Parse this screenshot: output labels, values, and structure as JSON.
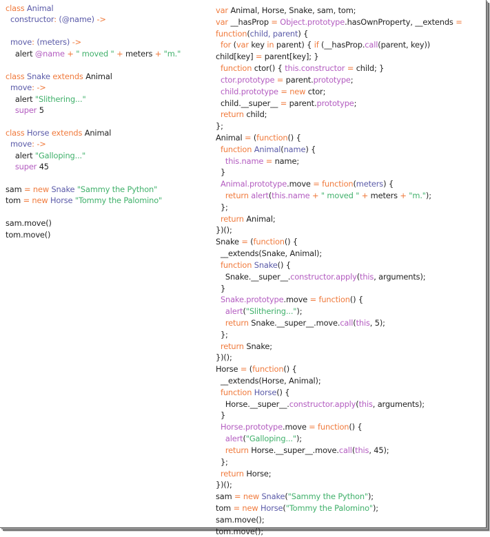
{
  "colors": {
    "keyword": "#f07a3c",
    "class_name": "#5a5aa8",
    "property": "#b35cc0",
    "string": "#3fb06a",
    "plain": "#1f1f1f",
    "background": "#ffffff"
  },
  "coffeescript": {
    "language": "CoffeeScript",
    "lines": [
      [
        [
          "kw",
          "class "
        ],
        [
          "cls",
          "Animal"
        ]
      ],
      [
        [
          "plain",
          "  "
        ],
        [
          "cls",
          "constructor"
        ],
        [
          "kw",
          ": "
        ],
        [
          "cls",
          "(@name) "
        ],
        [
          "kw",
          "->"
        ]
      ],
      [],
      [
        [
          "plain",
          "  "
        ],
        [
          "cls",
          "move"
        ],
        [
          "kw",
          ": "
        ],
        [
          "cls",
          "(meters) "
        ],
        [
          "kw",
          "->"
        ]
      ],
      [
        [
          "plain",
          "    alert "
        ],
        [
          "prop",
          "@name"
        ],
        [
          "kw",
          " + "
        ],
        [
          "str",
          "\" moved \""
        ],
        [
          "kw",
          " + "
        ],
        [
          "plain",
          "meters"
        ],
        [
          "kw",
          " + "
        ],
        [
          "str",
          "\"m.\""
        ]
      ],
      [],
      [
        [
          "kw",
          "class "
        ],
        [
          "cls",
          "Snake "
        ],
        [
          "kw",
          "extends "
        ],
        [
          "plain",
          "Animal"
        ]
      ],
      [
        [
          "plain",
          "  "
        ],
        [
          "cls",
          "move"
        ],
        [
          "kw",
          ": ->"
        ]
      ],
      [
        [
          "plain",
          "    alert "
        ],
        [
          "str",
          "\"Slithering...\""
        ]
      ],
      [
        [
          "plain",
          "    "
        ],
        [
          "prop",
          "super "
        ],
        [
          "plain",
          "5"
        ]
      ],
      [],
      [
        [
          "kw",
          "class "
        ],
        [
          "cls",
          "Horse "
        ],
        [
          "kw",
          "extends "
        ],
        [
          "plain",
          "Animal"
        ]
      ],
      [
        [
          "plain",
          "  "
        ],
        [
          "cls",
          "move"
        ],
        [
          "kw",
          ": ->"
        ]
      ],
      [
        [
          "plain",
          "    alert "
        ],
        [
          "str",
          "\"Galloping...\""
        ]
      ],
      [
        [
          "plain",
          "    "
        ],
        [
          "prop",
          "super "
        ],
        [
          "plain",
          "45"
        ]
      ],
      [],
      [
        [
          "plain",
          "sam "
        ],
        [
          "kw",
          "= new "
        ],
        [
          "cls",
          "Snake "
        ],
        [
          "str",
          "\"Sammy the Python\""
        ]
      ],
      [
        [
          "plain",
          "tom "
        ],
        [
          "kw",
          "= new "
        ],
        [
          "cls",
          "Horse "
        ],
        [
          "str",
          "\"Tommy the Palomino\""
        ]
      ],
      [],
      [
        [
          "plain",
          "sam.move()"
        ]
      ],
      [
        [
          "plain",
          "tom.move()"
        ]
      ]
    ]
  },
  "javascript": {
    "language": "JavaScript",
    "lines": [
      [
        [
          "kw",
          "var "
        ],
        [
          "plain",
          "Animal, Horse, Snake, sam, tom;"
        ]
      ],
      [
        [
          "kw",
          "var "
        ],
        [
          "plain",
          "__hasProp "
        ],
        [
          "kw",
          "= "
        ],
        [
          "prop",
          "Object.prototype"
        ],
        [
          "plain",
          ".hasOwnProperty, __extends "
        ],
        [
          "kw",
          "="
        ]
      ],
      [
        [
          "kw",
          "function"
        ],
        [
          "plain",
          "("
        ],
        [
          "cls",
          "child, parent"
        ],
        [
          "plain",
          ") {"
        ]
      ],
      [
        [
          "plain",
          "  "
        ],
        [
          "kw",
          "for "
        ],
        [
          "plain",
          "("
        ],
        [
          "kw",
          "var "
        ],
        [
          "plain",
          "key "
        ],
        [
          "kw",
          "in "
        ],
        [
          "plain",
          "parent) { "
        ],
        [
          "kw",
          "if "
        ],
        [
          "plain",
          "(__hasProp."
        ],
        [
          "prop",
          "call"
        ],
        [
          "plain",
          "(parent, key))"
        ]
      ],
      [
        [
          "plain",
          "child[key] "
        ],
        [
          "kw",
          "= "
        ],
        [
          "plain",
          "parent[key]; }"
        ]
      ],
      [
        [
          "plain",
          "  "
        ],
        [
          "kw",
          "function "
        ],
        [
          "plain",
          "ctor() { "
        ],
        [
          "prop",
          "this.constructor "
        ],
        [
          "kw",
          "= "
        ],
        [
          "plain",
          "child; }"
        ]
      ],
      [
        [
          "plain",
          "  "
        ],
        [
          "prop",
          "ctor.prototype "
        ],
        [
          "kw",
          "= "
        ],
        [
          "plain",
          "parent."
        ],
        [
          "prop",
          "prototype"
        ],
        [
          "plain",
          ";"
        ]
      ],
      [
        [
          "plain",
          "  "
        ],
        [
          "prop",
          "child.prototype "
        ],
        [
          "kw",
          "= new "
        ],
        [
          "plain",
          "ctor;"
        ]
      ],
      [
        [
          "plain",
          "  child.__super__ "
        ],
        [
          "kw",
          "= "
        ],
        [
          "plain",
          "parent."
        ],
        [
          "prop",
          "prototype"
        ],
        [
          "plain",
          ";"
        ]
      ],
      [
        [
          "plain",
          "  "
        ],
        [
          "kw",
          "return "
        ],
        [
          "plain",
          "child;"
        ]
      ],
      [
        [
          "plain",
          "};"
        ]
      ],
      [
        [
          "plain",
          "Animal "
        ],
        [
          "kw",
          "= "
        ],
        [
          "plain",
          "("
        ],
        [
          "kw",
          "function"
        ],
        [
          "plain",
          "() {"
        ]
      ],
      [
        [
          "plain",
          "  "
        ],
        [
          "kw",
          "function "
        ],
        [
          "cls",
          "Animal"
        ],
        [
          "plain",
          "("
        ],
        [
          "cls",
          "name"
        ],
        [
          "plain",
          ") {"
        ]
      ],
      [
        [
          "plain",
          "    "
        ],
        [
          "prop",
          "this.name "
        ],
        [
          "kw",
          "= "
        ],
        [
          "plain",
          "name;"
        ]
      ],
      [
        [
          "plain",
          "  }"
        ]
      ],
      [
        [
          "plain",
          "  "
        ],
        [
          "prop",
          "Animal.prototype"
        ],
        [
          "plain",
          ".move "
        ],
        [
          "kw",
          "= function"
        ],
        [
          "plain",
          "("
        ],
        [
          "cls",
          "meters"
        ],
        [
          "plain",
          ") {"
        ]
      ],
      [
        [
          "plain",
          "    "
        ],
        [
          "kw",
          "return "
        ],
        [
          "prop",
          "alert"
        ],
        [
          "plain",
          "("
        ],
        [
          "prop",
          "this.name "
        ],
        [
          "kw",
          "+ "
        ],
        [
          "str",
          "\" moved \""
        ],
        [
          "kw",
          " + "
        ],
        [
          "plain",
          "meters "
        ],
        [
          "kw",
          "+ "
        ],
        [
          "str",
          "\"m.\""
        ],
        [
          "plain",
          ");"
        ]
      ],
      [
        [
          "plain",
          "  };"
        ]
      ],
      [
        [
          "plain",
          "  "
        ],
        [
          "kw",
          "return "
        ],
        [
          "plain",
          "Animal;"
        ]
      ],
      [
        [
          "plain",
          "})();"
        ]
      ],
      [
        [
          "plain",
          "Snake "
        ],
        [
          "kw",
          "= "
        ],
        [
          "plain",
          "("
        ],
        [
          "kw",
          "function"
        ],
        [
          "plain",
          "() {"
        ]
      ],
      [
        [
          "plain",
          "  __extends(Snake, Animal);"
        ]
      ],
      [
        [
          "plain",
          "  "
        ],
        [
          "kw",
          "function "
        ],
        [
          "cls",
          "Snake"
        ],
        [
          "plain",
          "() {"
        ]
      ],
      [
        [
          "plain",
          "    Snake.__super__."
        ],
        [
          "prop",
          "constructor.apply"
        ],
        [
          "plain",
          "("
        ],
        [
          "prop",
          "this"
        ],
        [
          "plain",
          ", arguments);"
        ]
      ],
      [
        [
          "plain",
          "  }"
        ]
      ],
      [
        [
          "plain",
          "  "
        ],
        [
          "prop",
          "Snake.prototype"
        ],
        [
          "plain",
          ".move "
        ],
        [
          "kw",
          "= function"
        ],
        [
          "plain",
          "() {"
        ]
      ],
      [
        [
          "plain",
          "    "
        ],
        [
          "prop",
          "alert"
        ],
        [
          "plain",
          "("
        ],
        [
          "str",
          "\"Slithering...\""
        ],
        [
          "plain",
          ");"
        ]
      ],
      [
        [
          "plain",
          "    "
        ],
        [
          "kw",
          "return "
        ],
        [
          "plain",
          "Snake.__super__.move."
        ],
        [
          "prop",
          "call"
        ],
        [
          "plain",
          "("
        ],
        [
          "prop",
          "this"
        ],
        [
          "plain",
          ", 5);"
        ]
      ],
      [
        [
          "plain",
          "  };"
        ]
      ],
      [
        [
          "plain",
          "  "
        ],
        [
          "kw",
          "return "
        ],
        [
          "plain",
          "Snake;"
        ]
      ],
      [
        [
          "plain",
          "})();"
        ]
      ],
      [
        [
          "plain",
          "Horse "
        ],
        [
          "kw",
          "= "
        ],
        [
          "plain",
          "("
        ],
        [
          "kw",
          "function"
        ],
        [
          "plain",
          "() {"
        ]
      ],
      [
        [
          "plain",
          "  __extends(Horse, Animal);"
        ]
      ],
      [
        [
          "plain",
          "  "
        ],
        [
          "kw",
          "function "
        ],
        [
          "cls",
          "Horse"
        ],
        [
          "plain",
          "() {"
        ]
      ],
      [
        [
          "plain",
          "    Horse.__super__."
        ],
        [
          "prop",
          "constructor.apply"
        ],
        [
          "plain",
          "("
        ],
        [
          "prop",
          "this"
        ],
        [
          "plain",
          ", arguments);"
        ]
      ],
      [
        [
          "plain",
          "  }"
        ]
      ],
      [
        [
          "plain",
          "  "
        ],
        [
          "prop",
          "Horse.prototype"
        ],
        [
          "plain",
          ".move "
        ],
        [
          "kw",
          "= function"
        ],
        [
          "plain",
          "() {"
        ]
      ],
      [
        [
          "plain",
          "    "
        ],
        [
          "prop",
          "alert"
        ],
        [
          "plain",
          "("
        ],
        [
          "str",
          "\"Galloping...\""
        ],
        [
          "plain",
          ");"
        ]
      ],
      [
        [
          "plain",
          "    "
        ],
        [
          "kw",
          "return "
        ],
        [
          "plain",
          "Horse.__super__.move."
        ],
        [
          "prop",
          "call"
        ],
        [
          "plain",
          "("
        ],
        [
          "prop",
          "this"
        ],
        [
          "plain",
          ", 45);"
        ]
      ],
      [
        [
          "plain",
          "  };"
        ]
      ],
      [
        [
          "plain",
          "  "
        ],
        [
          "kw",
          "return "
        ],
        [
          "plain",
          "Horse;"
        ]
      ],
      [
        [
          "plain",
          "})();"
        ]
      ],
      [
        [
          "plain",
          "sam "
        ],
        [
          "kw",
          "= new "
        ],
        [
          "cls",
          "Snake"
        ],
        [
          "plain",
          "("
        ],
        [
          "str",
          "\"Sammy the Python\""
        ],
        [
          "plain",
          ");"
        ]
      ],
      [
        [
          "plain",
          "tom "
        ],
        [
          "kw",
          "= new "
        ],
        [
          "cls",
          "Horse"
        ],
        [
          "plain",
          "("
        ],
        [
          "str",
          "\"Tommy the Palomino\""
        ],
        [
          "plain",
          ");"
        ]
      ],
      [
        [
          "plain",
          "sam.move();"
        ]
      ],
      [
        [
          "plain",
          "tom.move();"
        ]
      ]
    ]
  }
}
